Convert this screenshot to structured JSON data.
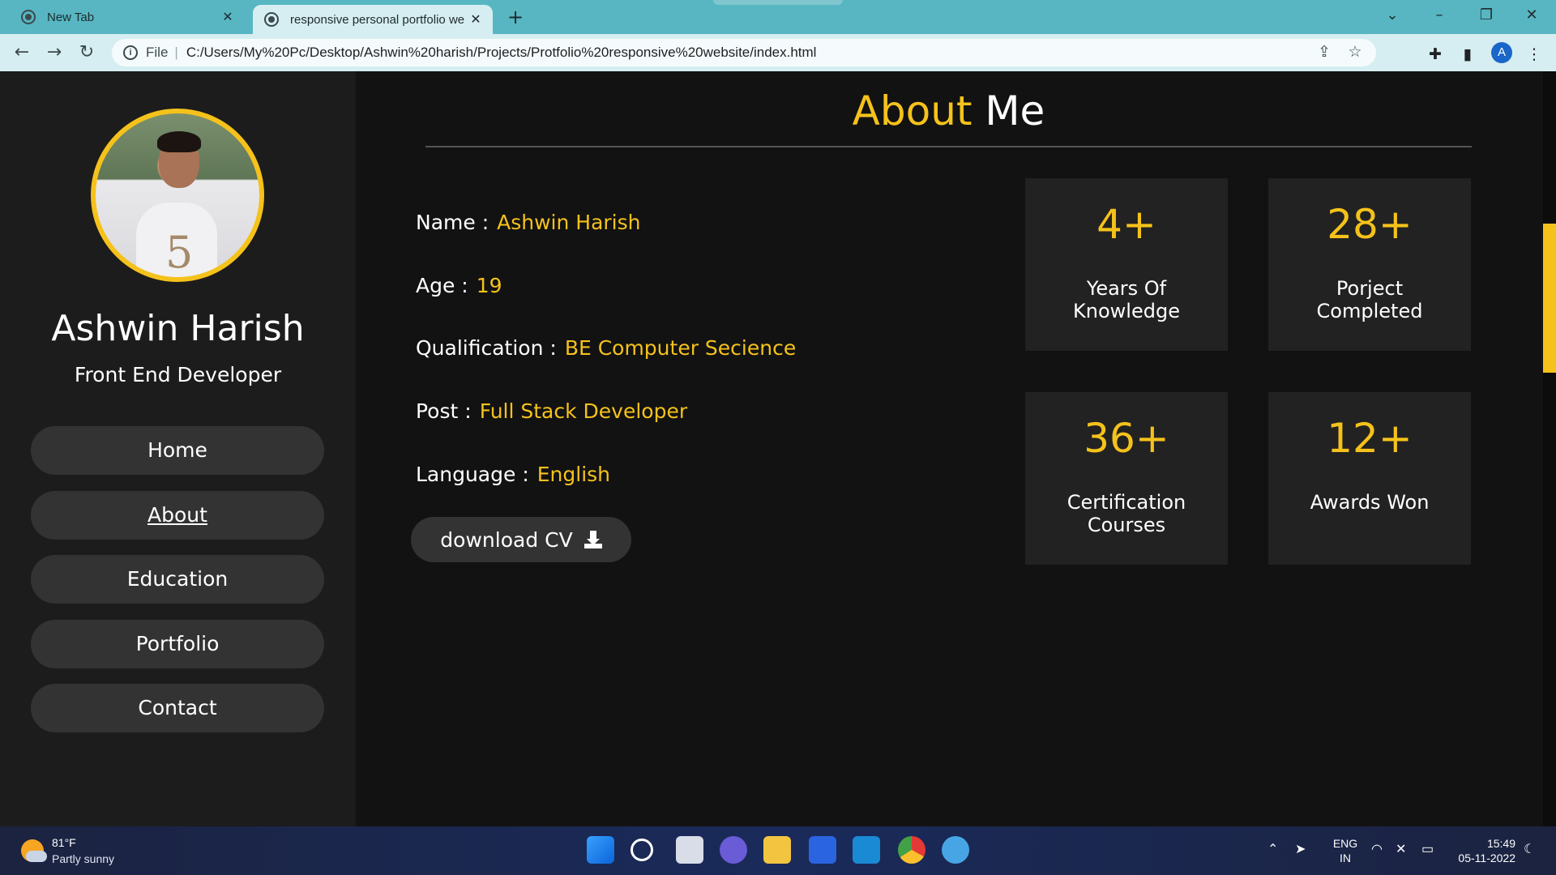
{
  "browser": {
    "tabs": [
      {
        "title": "New Tab",
        "active": false
      },
      {
        "title": "responsive personal portfolio we",
        "active": true
      }
    ],
    "address": {
      "scheme": "File",
      "url": "C:/Users/My%20Pc/Desktop/Ashwin%20harish/Projects/Protfolio%20responsive%20website/index.html"
    },
    "profile_initial": "A"
  },
  "sidebar": {
    "name": "Ashwin Harish",
    "role": "Front End Developer",
    "nav": [
      {
        "label": "Home",
        "active": false
      },
      {
        "label": "About",
        "active": true
      },
      {
        "label": "Education",
        "active": false
      },
      {
        "label": "Portfolio",
        "active": false
      },
      {
        "label": "Contact",
        "active": false
      }
    ]
  },
  "about": {
    "heading_accent": "About",
    "heading_rest": "Me",
    "info": [
      {
        "label": "Name :",
        "value": "Ashwin Harish"
      },
      {
        "label": "Age :",
        "value": "19"
      },
      {
        "label": "Qualification :",
        "value": "BE Computer Secience"
      },
      {
        "label": "Post :",
        "value": "Full Stack Developer"
      },
      {
        "label": "Language :",
        "value": "English"
      }
    ],
    "cv_button": "download CV",
    "stats": [
      {
        "number": "4+",
        "label_line1": "Years Of",
        "label_line2": "Knowledge"
      },
      {
        "number": "28+",
        "label_line1": "Porject",
        "label_line2": "Completed"
      },
      {
        "number": "36+",
        "label_line1": "Certification",
        "label_line2": "Courses"
      },
      {
        "number": "12+",
        "label_line1": "Awards Won",
        "label_line2": ""
      }
    ]
  },
  "taskbar": {
    "weather_temp": "81°F",
    "weather_desc": "Partly sunny",
    "lang_line1": "ENG",
    "lang_line2": "IN",
    "time": "15:49",
    "date": "05-11-2022"
  },
  "colors": {
    "accent": "#f5c21b",
    "sidebar_bg": "#1c1c1c",
    "page_bg": "#121212",
    "button_bg": "#333333",
    "stat_bg": "#222222"
  }
}
